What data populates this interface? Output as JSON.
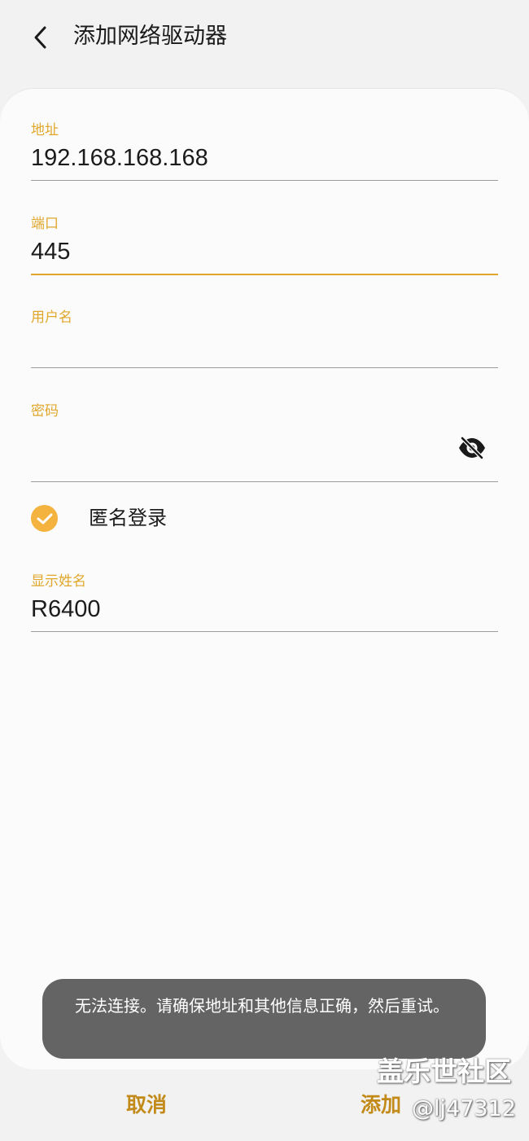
{
  "header": {
    "back_icon": "chevron-left-icon",
    "title": "添加网络驱动器"
  },
  "form": {
    "address": {
      "label": "地址",
      "value": "192.168.168.168"
    },
    "port": {
      "label": "端口",
      "value": "445"
    },
    "username": {
      "label": "用户名",
      "value": ""
    },
    "password": {
      "label": "密码",
      "value": "",
      "toggle_icon": "eye-off-icon"
    },
    "anonymous": {
      "label": "匿名登录",
      "checked": true
    },
    "display_name": {
      "label": "显示姓名",
      "value": "R6400"
    }
  },
  "toast": {
    "message": "无法连接。请确保地址和其他信息正确，然后重试。"
  },
  "bottom": {
    "cancel_label": "取消",
    "add_label": "添加"
  },
  "watermark": {
    "site": "盖乐世社区",
    "user": "@lj47312"
  },
  "colors": {
    "accent": "#e0a72c",
    "button_text": "#c28a18",
    "toast_bg": "#646464"
  }
}
